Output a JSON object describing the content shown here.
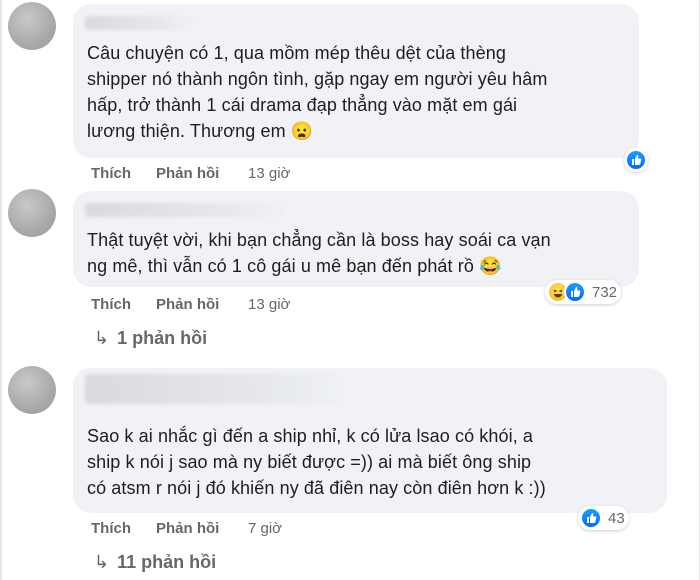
{
  "comments": [
    {
      "lines": [
        "Câu chuyện có 1, qua mồm mép thêu dệt của thèng",
        "shipper nó thành ngôn tình, gặp ngay em người yêu hâm",
        "hấp, trở thành 1 cái drama đạp thẳng vào mặt em gái",
        "lương thiện. Thương em 😦"
      ],
      "like_label": "Thích",
      "reply_label": "Phản hồi",
      "time": "13 giờ",
      "reactions": [
        "like"
      ],
      "reaction_count": ""
    },
    {
      "lines": [
        "Thật tuyệt vời, khi bạn chẳng cần là boss hay soái ca vạn",
        "ng mê, thì vẫn có 1 cô gái u mê bạn đến phát rồ 😂"
      ],
      "like_label": "Thích",
      "reply_label": "Phản hồi",
      "time": "13 giờ",
      "reactions": [
        "haha",
        "like"
      ],
      "reaction_count": "732",
      "replies_label": "1 phản hồi"
    },
    {
      "lines": [
        "Sao k ai nhắc gì đến a ship nhỉ, k có lửa lsao có khói, a",
        "ship k nói j sao mà ny biết được =)) ai mà biết ông ship",
        "có atsm r nói j đó khiến ny đã điên nay còn điên hơn k :))"
      ],
      "like_label": "Thích",
      "reply_label": "Phản hồi",
      "time": "7 giờ",
      "reactions": [
        "like"
      ],
      "reaction_count": "43",
      "replies_label": "11 phản hồi"
    }
  ],
  "icons": {
    "reply_arrow": "reply-arrow-icon",
    "like": "like-reaction-icon",
    "haha": "haha-reaction-icon"
  },
  "colors": {
    "bubble": "#f0f2f5",
    "meta": "#65676b",
    "like_blue": "#0866ff"
  }
}
